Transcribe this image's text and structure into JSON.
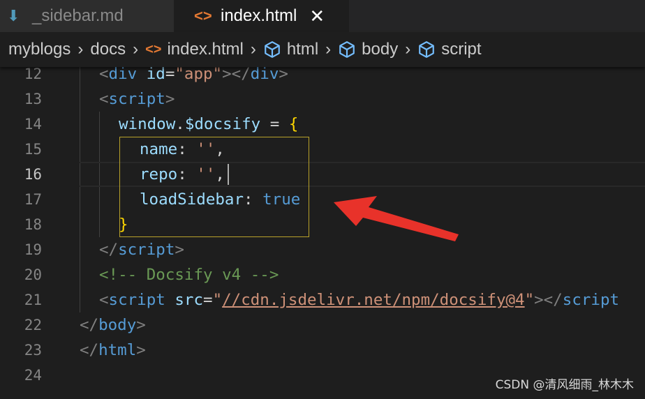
{
  "tabs": [
    {
      "label": "_sidebar.md",
      "active": false
    },
    {
      "label": "index.html",
      "active": true,
      "close": "✕"
    }
  ],
  "breadcrumb": [
    "myblogs",
    "docs",
    "index.html",
    "html",
    "body",
    "script"
  ],
  "editor": {
    "current_line": 16,
    "lines": [
      {
        "num": "12",
        "tokens": [
          {
            "t": "<",
            "c": "t-punc"
          },
          {
            "t": "div",
            "c": "t-tag"
          },
          {
            "t": " ",
            "c": "t-op"
          },
          {
            "t": "id",
            "c": "t-attr"
          },
          {
            "t": "=",
            "c": "t-op"
          },
          {
            "t": "\"app\"",
            "c": "t-str"
          },
          {
            "t": "></",
            "c": "t-punc"
          },
          {
            "t": "div",
            "c": "t-tag"
          },
          {
            "t": ">",
            "c": "t-punc"
          }
        ]
      },
      {
        "num": "13",
        "tokens": [
          {
            "t": "<",
            "c": "t-punc"
          },
          {
            "t": "script",
            "c": "t-tag"
          },
          {
            "t": ">",
            "c": "t-punc"
          }
        ]
      },
      {
        "num": "14",
        "tokens": [
          {
            "t": "window",
            "c": "t-var"
          },
          {
            "t": ".",
            "c": "t-op"
          },
          {
            "t": "$docsify",
            "c": "t-var"
          },
          {
            "t": " = ",
            "c": "t-op"
          },
          {
            "t": "{",
            "c": "t-brace"
          }
        ]
      },
      {
        "num": "15",
        "tokens": [
          {
            "t": "name",
            "c": "t-var"
          },
          {
            "t": ": ",
            "c": "t-op"
          },
          {
            "t": "''",
            "c": "t-str"
          },
          {
            "t": ",",
            "c": "t-op"
          }
        ]
      },
      {
        "num": "16",
        "tokens": [
          {
            "t": "repo",
            "c": "t-var"
          },
          {
            "t": ": ",
            "c": "t-op"
          },
          {
            "t": "''",
            "c": "t-str"
          },
          {
            "t": ",",
            "c": "t-op"
          }
        ]
      },
      {
        "num": "17",
        "tokens": [
          {
            "t": "loadSidebar",
            "c": "t-var"
          },
          {
            "t": ": ",
            "c": "t-op"
          },
          {
            "t": "true",
            "c": "t-bool"
          }
        ]
      },
      {
        "num": "18",
        "tokens": [
          {
            "t": "}",
            "c": "t-brace"
          }
        ]
      },
      {
        "num": "19",
        "tokens": [
          {
            "t": "</",
            "c": "t-punc"
          },
          {
            "t": "script",
            "c": "t-tag"
          },
          {
            "t": ">",
            "c": "t-punc"
          }
        ]
      },
      {
        "num": "20",
        "tokens": [
          {
            "t": "<!-- Docsify v4 -->",
            "c": "t-comment"
          }
        ]
      },
      {
        "num": "21",
        "tokens": [
          {
            "t": "<",
            "c": "t-punc"
          },
          {
            "t": "script",
            "c": "t-tag"
          },
          {
            "t": " ",
            "c": "t-op"
          },
          {
            "t": "src",
            "c": "t-attr"
          },
          {
            "t": "=",
            "c": "t-op"
          },
          {
            "t": "\"",
            "c": "t-str"
          },
          {
            "t": "//cdn.jsdelivr.net/npm/docsify@4",
            "c": "t-url"
          },
          {
            "t": "\"",
            "c": "t-str"
          },
          {
            "t": "></",
            "c": "t-punc"
          },
          {
            "t": "script",
            "c": "t-tag"
          }
        ]
      },
      {
        "num": "22",
        "tokens": [
          {
            "t": "</",
            "c": "t-punc"
          },
          {
            "t": "body",
            "c": "t-tag"
          },
          {
            "t": ">",
            "c": "t-punc"
          }
        ]
      },
      {
        "num": "23",
        "tokens": [
          {
            "t": "</",
            "c": "t-punc"
          },
          {
            "t": "html",
            "c": "t-tag"
          },
          {
            "t": ">",
            "c": "t-punc"
          }
        ]
      },
      {
        "num": "24",
        "tokens": []
      }
    ]
  },
  "annotation": {
    "arrow_color": "#e8322a"
  },
  "watermark": "CSDN @清风细雨_林木木",
  "colors": {
    "background": "#1e1e1e",
    "tag": "#569cd6",
    "string": "#ce9178",
    "variable": "#9cdcfe",
    "comment": "#6a9955",
    "brace": "#ffd700"
  }
}
